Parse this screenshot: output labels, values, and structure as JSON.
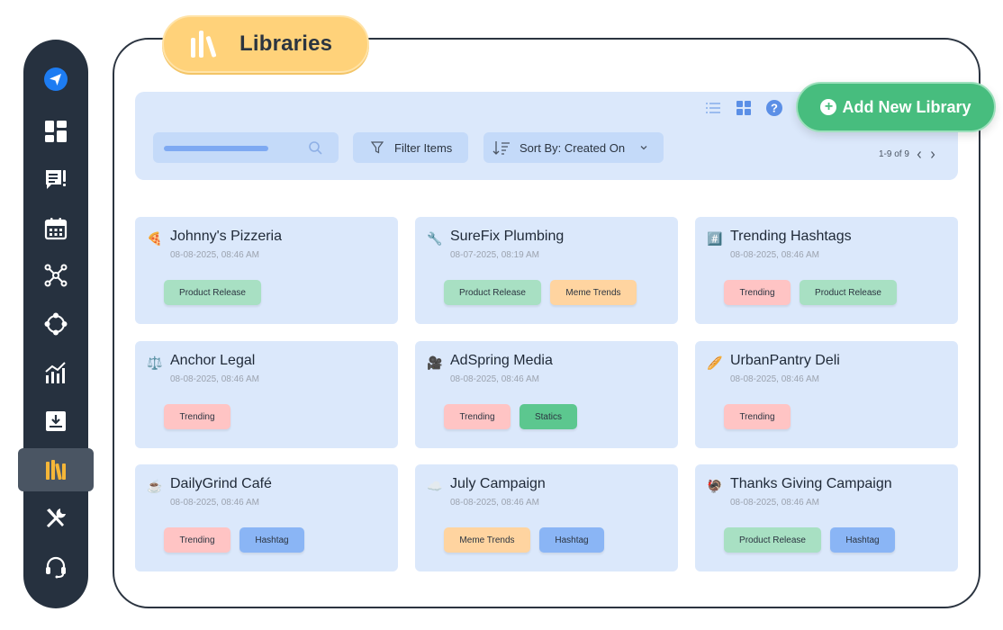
{
  "page": {
    "title": "Libraries",
    "title_icon": "library-books-icon"
  },
  "sidebar": {
    "items": [
      {
        "name": "send",
        "icon": "send-icon"
      },
      {
        "name": "dashboard",
        "icon": "dashboard-icon"
      },
      {
        "name": "feedback",
        "icon": "feedback-icon"
      },
      {
        "name": "calendar",
        "icon": "calendar-icon"
      },
      {
        "name": "network",
        "icon": "network-icon"
      },
      {
        "name": "integrations",
        "icon": "hub-icon"
      },
      {
        "name": "analytics",
        "icon": "analytics-icon"
      },
      {
        "name": "downloads",
        "icon": "inbox-download-icon"
      },
      {
        "name": "libraries",
        "icon": "library-books-icon",
        "active": true
      },
      {
        "name": "tools",
        "icon": "tools-icon"
      },
      {
        "name": "support",
        "icon": "headset-icon"
      }
    ]
  },
  "toolbar": {
    "search_placeholder": "",
    "filter_label": "Filter Items",
    "sort_label": "Sort By: Created On",
    "pager_text": "1-9 of 9",
    "add_label": "Add New Library"
  },
  "colors": {
    "accent_green": "#47bd7e",
    "sidebar_bg": "#26313f",
    "title_pill": "#ffd27a",
    "card_bg": "#dbe8fb"
  },
  "libraries": [
    {
      "emoji": "🍕",
      "name": "Johnny's Pizzeria",
      "date": "08-08-2025, 08:46 AM",
      "tags": [
        {
          "label": "Product Release",
          "color": "green"
        }
      ]
    },
    {
      "emoji": "🔧",
      "name": "SureFix Plumbing",
      "date": "08-07-2025, 08:19 AM",
      "tags": [
        {
          "label": "Product Release",
          "color": "green"
        },
        {
          "label": "Meme Trends",
          "color": "orange"
        }
      ]
    },
    {
      "emoji": "#️⃣",
      "name": "Trending Hashtags",
      "date": "08-08-2025, 08:46 AM",
      "tags": [
        {
          "label": "Trending",
          "color": "pink"
        },
        {
          "label": "Product Release",
          "color": "green"
        }
      ]
    },
    {
      "emoji": "⚖️",
      "name": "Anchor Legal",
      "date": "08-08-2025, 08:46 AM",
      "tags": [
        {
          "label": "Trending",
          "color": "pink"
        }
      ]
    },
    {
      "emoji": "🎥",
      "name": "AdSpring Media",
      "date": "08-08-2025, 08:46 AM",
      "tags": [
        {
          "label": "Trending",
          "color": "pink"
        },
        {
          "label": "Statics",
          "color": "teal"
        }
      ]
    },
    {
      "emoji": "🥖",
      "name": "UrbanPantry Deli",
      "date": "08-08-2025, 08:46 AM",
      "tags": [
        {
          "label": "Trending",
          "color": "pink"
        }
      ]
    },
    {
      "emoji": "☕",
      "name": "DailyGrind Café",
      "date": "08-08-2025, 08:46 AM",
      "tags": [
        {
          "label": "Trending",
          "color": "pink"
        },
        {
          "label": "Hashtag",
          "color": "blue"
        }
      ]
    },
    {
      "emoji": "☁️",
      "name": "July Campaign",
      "date": "08-08-2025, 08:46 AM",
      "tags": [
        {
          "label": "Meme Trends",
          "color": "orange"
        },
        {
          "label": "Hashtag",
          "color": "blue"
        }
      ]
    },
    {
      "emoji": "🦃",
      "name": "Thanks Giving Campaign",
      "date": "08-08-2025, 08:46 AM",
      "tags": [
        {
          "label": "Product Release",
          "color": "green"
        },
        {
          "label": "Hashtag",
          "color": "blue"
        }
      ]
    }
  ]
}
